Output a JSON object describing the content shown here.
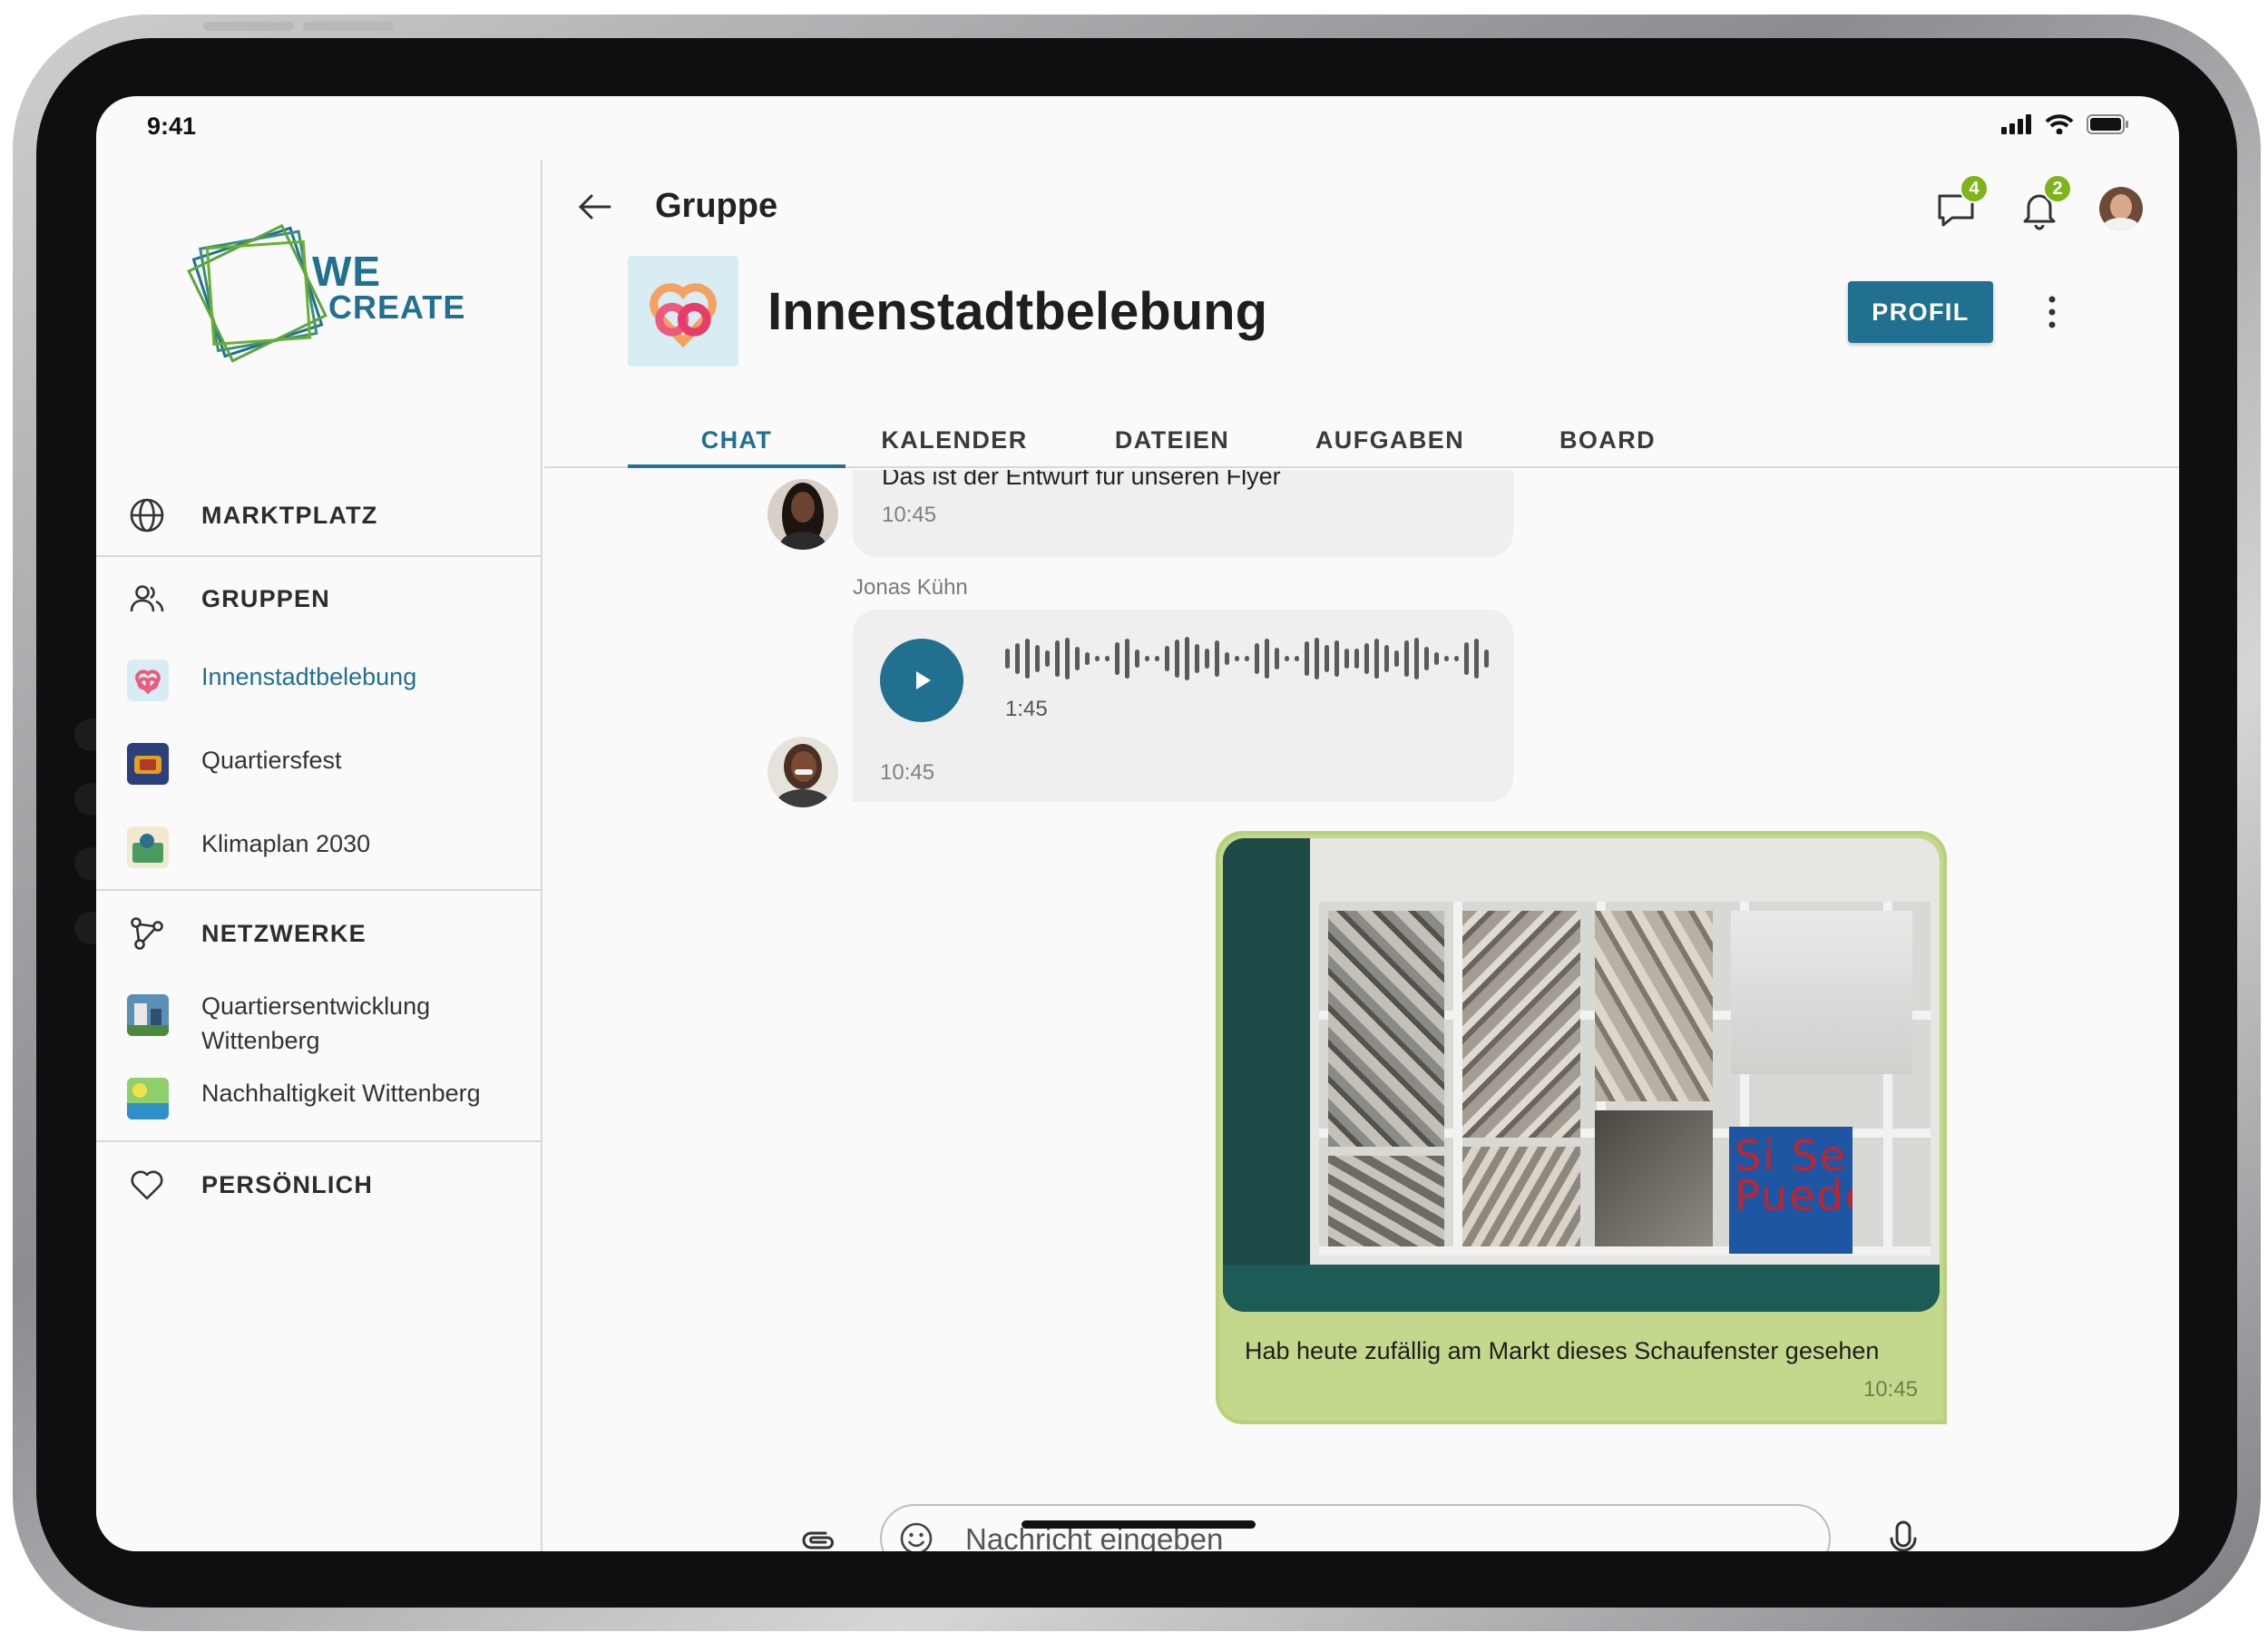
{
  "status_bar": {
    "time": "9:41"
  },
  "brand": {
    "line1": "WE",
    "line2": "CREATE"
  },
  "sidebar": {
    "marktplatz": "MARKTPLATZ",
    "gruppen": "GRUPPEN",
    "groups": [
      {
        "label": "Innenstadtbelebung",
        "active": true
      },
      {
        "label": "Quartiersfest"
      },
      {
        "label": "Klimaplan 2030"
      }
    ],
    "netzwerke": "NETZWERKE",
    "networks": [
      {
        "label_line1": "Quartiersentwicklung",
        "label_line2": "Wittenberg"
      },
      {
        "label_line1": "Nachhaltigkeit Wittenberg",
        "label_line2": ""
      }
    ],
    "persoenlich": "PERSÖNLICH"
  },
  "header": {
    "back_label": "Gruppe",
    "messages_badge": "4",
    "notifications_badge": "2",
    "group_title": "Innenstadtbelebung",
    "profile_button": "PROFIL"
  },
  "tabs": [
    "CHAT",
    "KALENDER",
    "DATEIEN",
    "AUFGABEN",
    "BOARD"
  ],
  "active_tab": "CHAT",
  "messages": [
    {
      "text": "Das ist der Entwurf für unseren Flyer",
      "time": "10:45"
    },
    {
      "sender": "Jonas Kühn",
      "type": "voice",
      "duration": "1:45",
      "time": "10:45"
    },
    {
      "own": true,
      "type": "image",
      "caption": "Hab heute zufällig am Markt dieses Schaufenster gesehen",
      "time": "10:45",
      "image_sign_text": "Si Se Puede"
    }
  ],
  "composer": {
    "placeholder": "Nachricht eingeben"
  },
  "colors": {
    "accent": "#21708f",
    "own_bubble": "#c3d88c",
    "own_bubble_border": "#b8d07a",
    "badge": "#7fb31a",
    "logo_blue": "#21708f",
    "logo_green": "#6ab02e"
  },
  "icons": [
    "globe-icon",
    "users-icon",
    "network-icon",
    "heart-icon",
    "back-arrow-icon",
    "chat-icon",
    "bell-icon",
    "more-vert-icon",
    "play-icon",
    "attachment-icon",
    "emoji-icon",
    "mic-icon",
    "signal-icon",
    "wifi-icon",
    "battery-icon"
  ]
}
